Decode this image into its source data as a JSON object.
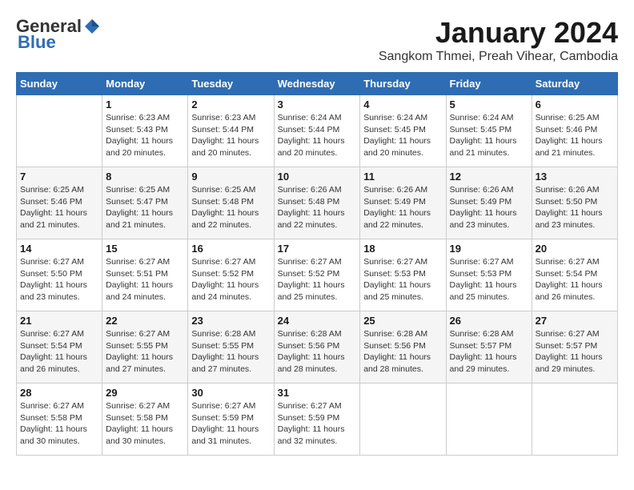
{
  "header": {
    "logo_general": "General",
    "logo_blue": "Blue",
    "title": "January 2024",
    "subtitle": "Sangkom Thmei, Preah Vihear, Cambodia"
  },
  "days_of_week": [
    "Sunday",
    "Monday",
    "Tuesday",
    "Wednesday",
    "Thursday",
    "Friday",
    "Saturday"
  ],
  "weeks": [
    [
      {
        "day": "",
        "info": ""
      },
      {
        "day": "1",
        "info": "Sunrise: 6:23 AM\nSunset: 5:43 PM\nDaylight: 11 hours\nand 20 minutes."
      },
      {
        "day": "2",
        "info": "Sunrise: 6:23 AM\nSunset: 5:44 PM\nDaylight: 11 hours\nand 20 minutes."
      },
      {
        "day": "3",
        "info": "Sunrise: 6:24 AM\nSunset: 5:44 PM\nDaylight: 11 hours\nand 20 minutes."
      },
      {
        "day": "4",
        "info": "Sunrise: 6:24 AM\nSunset: 5:45 PM\nDaylight: 11 hours\nand 20 minutes."
      },
      {
        "day": "5",
        "info": "Sunrise: 6:24 AM\nSunset: 5:45 PM\nDaylight: 11 hours\nand 21 minutes."
      },
      {
        "day": "6",
        "info": "Sunrise: 6:25 AM\nSunset: 5:46 PM\nDaylight: 11 hours\nand 21 minutes."
      }
    ],
    [
      {
        "day": "7",
        "info": "Sunrise: 6:25 AM\nSunset: 5:46 PM\nDaylight: 11 hours\nand 21 minutes."
      },
      {
        "day": "8",
        "info": "Sunrise: 6:25 AM\nSunset: 5:47 PM\nDaylight: 11 hours\nand 21 minutes."
      },
      {
        "day": "9",
        "info": "Sunrise: 6:25 AM\nSunset: 5:48 PM\nDaylight: 11 hours\nand 22 minutes."
      },
      {
        "day": "10",
        "info": "Sunrise: 6:26 AM\nSunset: 5:48 PM\nDaylight: 11 hours\nand 22 minutes."
      },
      {
        "day": "11",
        "info": "Sunrise: 6:26 AM\nSunset: 5:49 PM\nDaylight: 11 hours\nand 22 minutes."
      },
      {
        "day": "12",
        "info": "Sunrise: 6:26 AM\nSunset: 5:49 PM\nDaylight: 11 hours\nand 23 minutes."
      },
      {
        "day": "13",
        "info": "Sunrise: 6:26 AM\nSunset: 5:50 PM\nDaylight: 11 hours\nand 23 minutes."
      }
    ],
    [
      {
        "day": "14",
        "info": "Sunrise: 6:27 AM\nSunset: 5:50 PM\nDaylight: 11 hours\nand 23 minutes."
      },
      {
        "day": "15",
        "info": "Sunrise: 6:27 AM\nSunset: 5:51 PM\nDaylight: 11 hours\nand 24 minutes."
      },
      {
        "day": "16",
        "info": "Sunrise: 6:27 AM\nSunset: 5:52 PM\nDaylight: 11 hours\nand 24 minutes."
      },
      {
        "day": "17",
        "info": "Sunrise: 6:27 AM\nSunset: 5:52 PM\nDaylight: 11 hours\nand 25 minutes."
      },
      {
        "day": "18",
        "info": "Sunrise: 6:27 AM\nSunset: 5:53 PM\nDaylight: 11 hours\nand 25 minutes."
      },
      {
        "day": "19",
        "info": "Sunrise: 6:27 AM\nSunset: 5:53 PM\nDaylight: 11 hours\nand 25 minutes."
      },
      {
        "day": "20",
        "info": "Sunrise: 6:27 AM\nSunset: 5:54 PM\nDaylight: 11 hours\nand 26 minutes."
      }
    ],
    [
      {
        "day": "21",
        "info": "Sunrise: 6:27 AM\nSunset: 5:54 PM\nDaylight: 11 hours\nand 26 minutes."
      },
      {
        "day": "22",
        "info": "Sunrise: 6:27 AM\nSunset: 5:55 PM\nDaylight: 11 hours\nand 27 minutes."
      },
      {
        "day": "23",
        "info": "Sunrise: 6:28 AM\nSunset: 5:55 PM\nDaylight: 11 hours\nand 27 minutes."
      },
      {
        "day": "24",
        "info": "Sunrise: 6:28 AM\nSunset: 5:56 PM\nDaylight: 11 hours\nand 28 minutes."
      },
      {
        "day": "25",
        "info": "Sunrise: 6:28 AM\nSunset: 5:56 PM\nDaylight: 11 hours\nand 28 minutes."
      },
      {
        "day": "26",
        "info": "Sunrise: 6:28 AM\nSunset: 5:57 PM\nDaylight: 11 hours\nand 29 minutes."
      },
      {
        "day": "27",
        "info": "Sunrise: 6:27 AM\nSunset: 5:57 PM\nDaylight: 11 hours\nand 29 minutes."
      }
    ],
    [
      {
        "day": "28",
        "info": "Sunrise: 6:27 AM\nSunset: 5:58 PM\nDaylight: 11 hours\nand 30 minutes."
      },
      {
        "day": "29",
        "info": "Sunrise: 6:27 AM\nSunset: 5:58 PM\nDaylight: 11 hours\nand 30 minutes."
      },
      {
        "day": "30",
        "info": "Sunrise: 6:27 AM\nSunset: 5:59 PM\nDaylight: 11 hours\nand 31 minutes."
      },
      {
        "day": "31",
        "info": "Sunrise: 6:27 AM\nSunset: 5:59 PM\nDaylight: 11 hours\nand 32 minutes."
      },
      {
        "day": "",
        "info": ""
      },
      {
        "day": "",
        "info": ""
      },
      {
        "day": "",
        "info": ""
      }
    ]
  ]
}
